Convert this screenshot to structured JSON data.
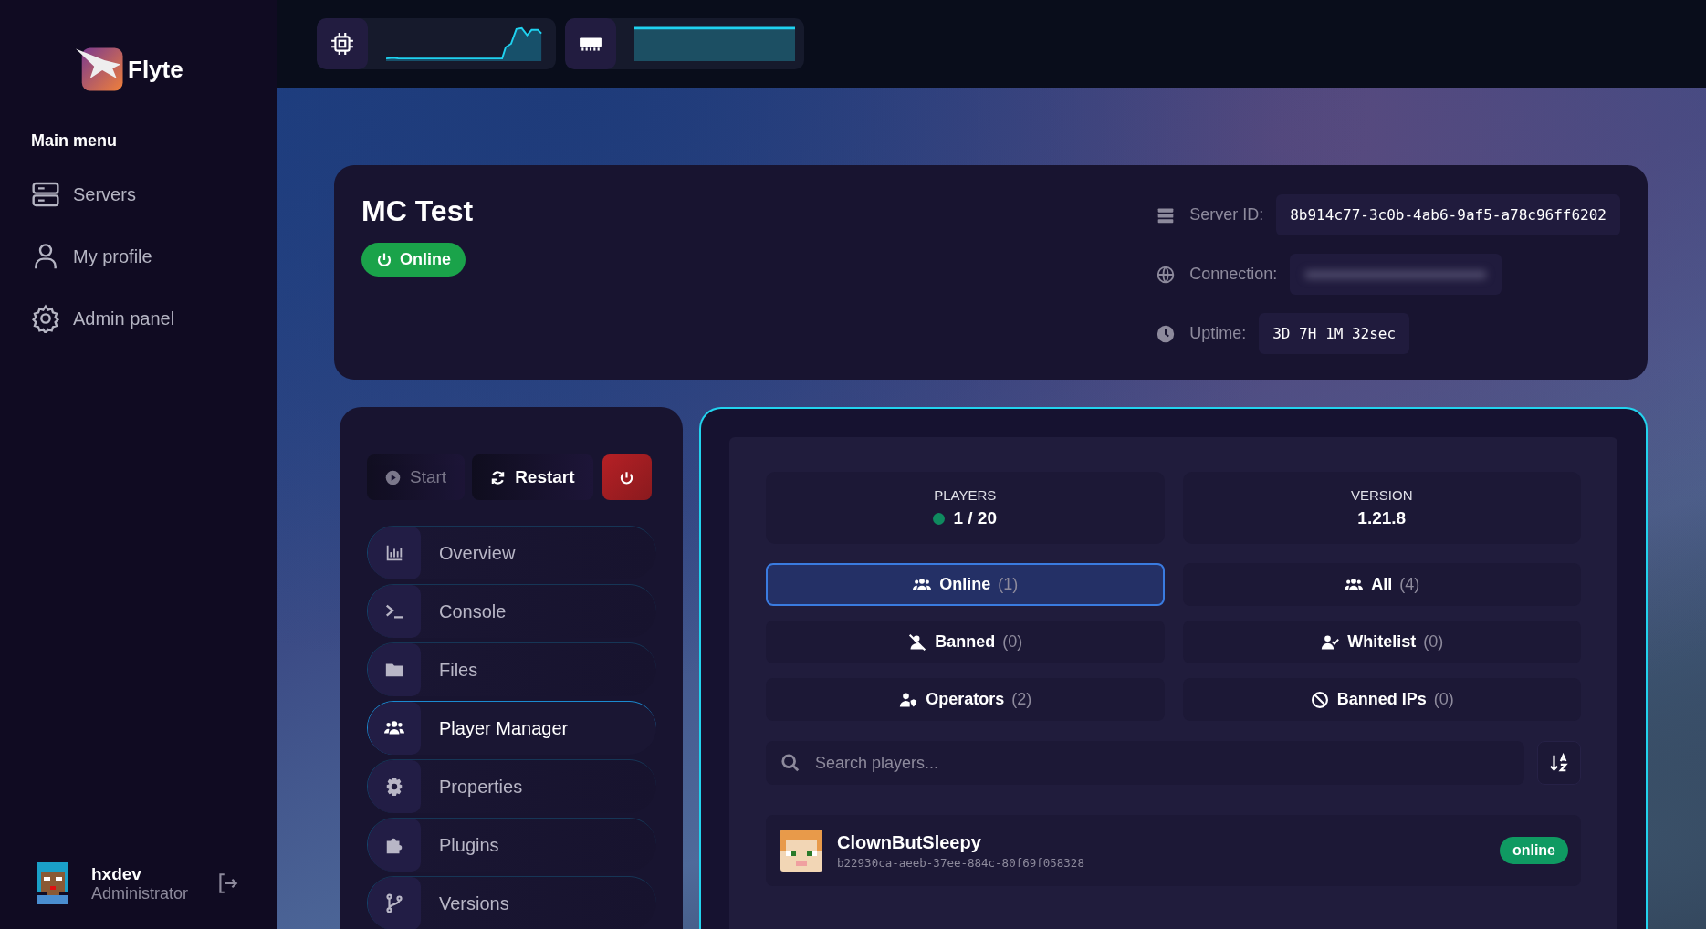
{
  "brand": {
    "name": "Flyte"
  },
  "sidebar": {
    "heading": "Main menu",
    "items": [
      {
        "label": "Servers",
        "selected": false
      },
      {
        "label": "My profile",
        "selected": false
      },
      {
        "label": "Admin panel",
        "selected": false
      }
    ]
  },
  "user": {
    "name": "hxdev",
    "role": "Administrator"
  },
  "server": {
    "name": "MC Test",
    "status": {
      "label": "Online",
      "on": true
    },
    "info": [
      {
        "label": "Server ID:",
        "value": "8b914c77-3c0b-4ab6-9af5-a78c96ff6202",
        "blurred": false
      },
      {
        "label": "Connection:",
        "blurred": true
      },
      {
        "label": "Uptime:",
        "value": "3D 7H 1M 32sec",
        "blurred": false
      }
    ]
  },
  "controls": [
    {
      "kind": "start",
      "label": "Start",
      "disabled": true
    },
    {
      "kind": "restart",
      "label": "Restart",
      "disabled": false
    },
    {
      "kind": "stop",
      "disabled": false
    }
  ],
  "nav": [
    {
      "label": "Overview",
      "selected": false
    },
    {
      "label": "Console",
      "selected": false
    },
    {
      "label": "Files",
      "selected": false
    },
    {
      "label": "Player Manager",
      "selected": true
    },
    {
      "label": "Properties",
      "selected": false
    },
    {
      "label": "Plugins",
      "selected": false
    },
    {
      "label": "Versions",
      "selected": false
    }
  ],
  "stats": [
    {
      "label": "PLAYERS",
      "value": "1 / 20",
      "online": true
    },
    {
      "label": "VERSION",
      "value": "1.21.8"
    }
  ],
  "tabs": [
    {
      "label": "Online",
      "count": "(1)",
      "selected": true
    },
    {
      "label": "All",
      "count": "(4)",
      "selected": false
    },
    {
      "label": "Banned",
      "count": "(0)",
      "selected": false
    },
    {
      "label": "Whitelist",
      "count": "(0)",
      "selected": false
    },
    {
      "label": "Operators",
      "count": "(2)",
      "selected": false
    },
    {
      "label": "Banned IPs",
      "count": "(0)",
      "selected": false
    }
  ],
  "search": {
    "placeholder": "Search players..."
  },
  "players": [
    {
      "name": "ClownButSleepy",
      "uuid": "b22930ca-aeeb-37ee-884c-80f69f058328",
      "status": "online"
    }
  ]
}
